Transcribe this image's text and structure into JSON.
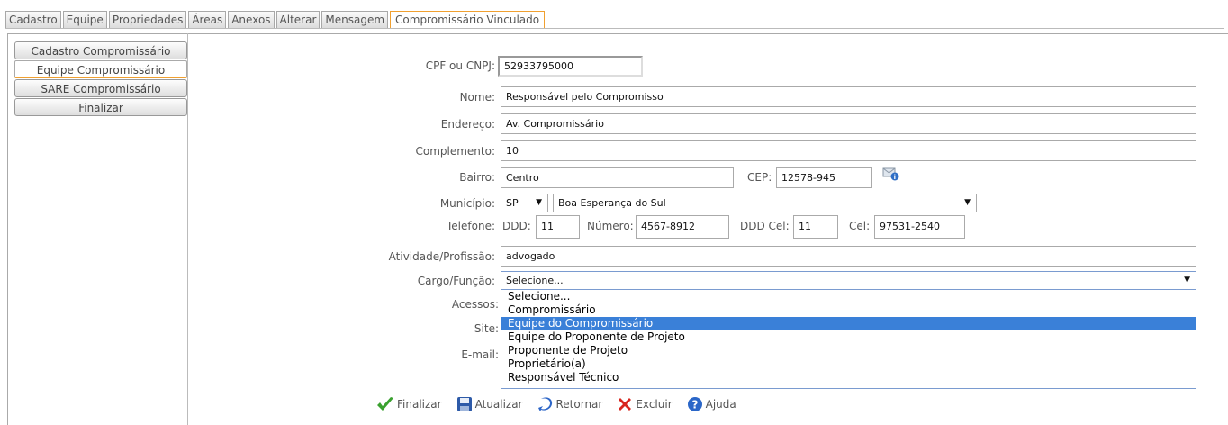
{
  "top_tabs": [
    "Cadastro",
    "Equipe",
    "Propriedades",
    "Áreas",
    "Anexos",
    "Alterar",
    "Mensagem",
    "Compromissário Vinculado"
  ],
  "sidebar": {
    "items": [
      "Cadastro Compromissário",
      "Equipe Compromissário",
      "SARE Compromissário",
      "Finalizar"
    ]
  },
  "form": {
    "cpf_label": "CPF ou CNPJ:",
    "cpf_value": "52933795000",
    "nome_label": "Nome:",
    "nome_value": "Responsável pelo Compromisso",
    "endereco_label": "Endereço:",
    "endereco_value": "Av. Compromissário",
    "complemento_label": "Complemento:",
    "complemento_value": "10",
    "bairro_label": "Bairro:",
    "bairro_value": "Centro",
    "cep_label": "CEP:",
    "cep_value": "12578-945",
    "municipio_label": "Município:",
    "uf_value": "SP",
    "municipio_value": "Boa Esperança do Sul",
    "telefone_label": "Telefone:",
    "ddd_label": "DDD:",
    "ddd_value": "11",
    "numero_label": "Número:",
    "numero_value": "4567-8912",
    "ddd_cel_label": "DDD Cel:",
    "ddd_cel_value": "11",
    "cel_label": "Cel:",
    "cel_value": "97531-2540",
    "atividade_label": "Atividade/Profissão:",
    "atividade_value": "advogado",
    "cargo_label": "Cargo/Função:",
    "cargo_value": "Selecione...",
    "acessos_label": "Acessos:",
    "site_label": "Site:",
    "email_label": "E-mail:"
  },
  "cargo_options": [
    "Selecione...",
    "Compromissário",
    "Equipe do Compromissário",
    "Equipe do Proponente de Projeto",
    "Proponente de Projeto",
    "Proprietário(a)",
    "Responsável Técnico"
  ],
  "actions": {
    "finalizar": "Finalizar",
    "atualizar": "Atualizar",
    "retornar": "Retornar",
    "excluir": "Excluir",
    "ajuda": "Ajuda"
  },
  "icons": {
    "finalizar": "checkmark-icon",
    "atualizar": "save-disk-icon",
    "retornar": "return-arrow-icon",
    "excluir": "red-x-icon",
    "ajuda": "help-icon",
    "cep_lookup": "mail-info-icon"
  },
  "colors": {
    "active_tab_border": "#f0a030",
    "selected_option_bg": "#3a80d8"
  }
}
